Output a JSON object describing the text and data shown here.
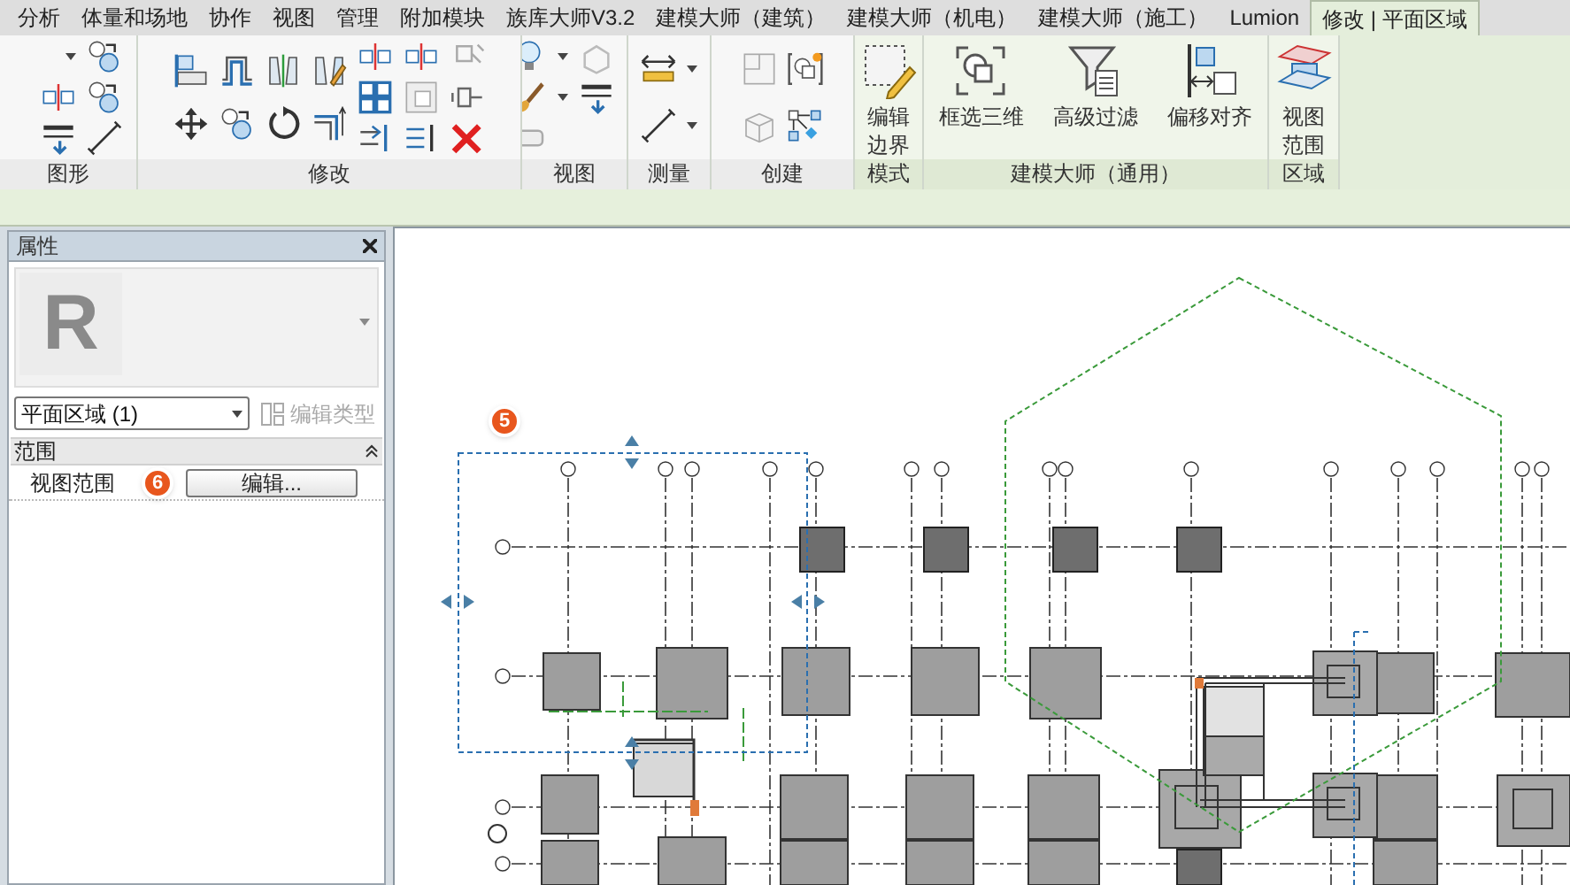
{
  "ribbon": {
    "tabs": [
      {
        "label": "分析",
        "selected": false
      },
      {
        "label": "体量和场地",
        "selected": false
      },
      {
        "label": "协作",
        "selected": false
      },
      {
        "label": "视图",
        "selected": false
      },
      {
        "label": "管理",
        "selected": false
      },
      {
        "label": "附加模块",
        "selected": false
      },
      {
        "label": "族库大师V3.2",
        "selected": false
      },
      {
        "label": "建模大师（建筑）",
        "selected": false
      },
      {
        "label": "建模大师（机电）",
        "selected": false
      },
      {
        "label": "建模大师（施工）",
        "selected": false
      },
      {
        "label": "Lumion",
        "selected": false
      },
      {
        "label": "修改 | 平面区域",
        "selected": true
      }
    ],
    "panels": [
      {
        "label": "图形",
        "kind": "graphics"
      },
      {
        "label": "修改",
        "kind": "modify"
      },
      {
        "label": "视图",
        "kind": "view"
      },
      {
        "label": "测量",
        "kind": "measure"
      },
      {
        "label": "创建",
        "kind": "create"
      },
      {
        "label": "模式",
        "kind": "tools",
        "tools": [
          {
            "label": "编辑边界"
          }
        ]
      },
      {
        "label": "建模大师（通用）",
        "kind": "tools",
        "tools": [
          {
            "label": "框选三维"
          },
          {
            "label": "高级过滤"
          },
          {
            "label": "偏移对齐"
          }
        ]
      },
      {
        "label": "区域",
        "kind": "tools",
        "tools": [
          {
            "label": "视图范围"
          }
        ]
      }
    ]
  },
  "properties": {
    "title": "属性",
    "preview_letter": "R",
    "type_selector": "平面区域 (1)",
    "edit_type": {
      "label": "编辑类型",
      "disabled": true
    },
    "sections": [
      {
        "label": "范围",
        "expanded": true,
        "rows": [
          {
            "name": "视图范围",
            "button": "编辑...",
            "callout": "6"
          }
        ]
      }
    ]
  },
  "canvas": {
    "callout": "5"
  }
}
